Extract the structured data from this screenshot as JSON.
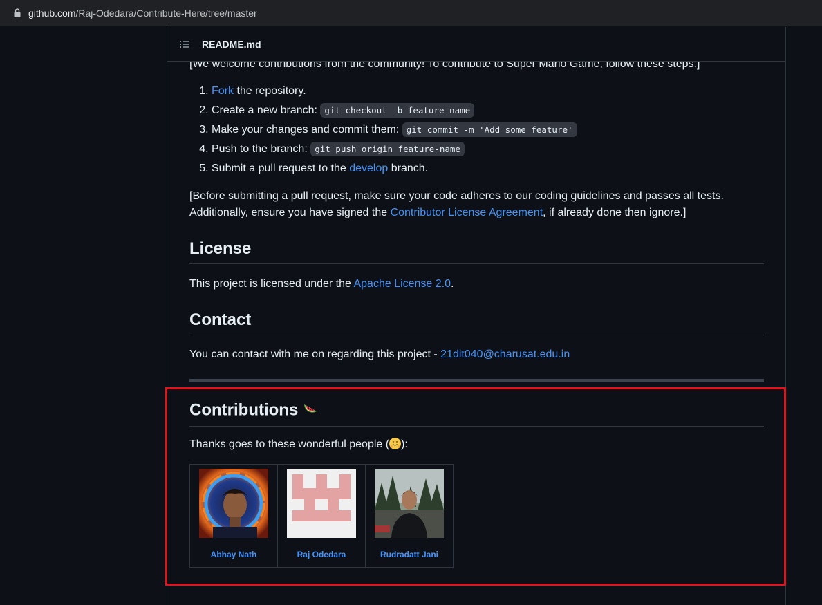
{
  "browser": {
    "url_host": "github.com",
    "url_path": "/Raj-Odedara/Contribute-Here/tree/master"
  },
  "readme": {
    "title": "README.md",
    "intro": "[We welcome contributions from the community! To contribute to Super Mario Game, follow these steps:]",
    "steps": [
      {
        "link": "Fork",
        "text": " the repository."
      },
      {
        "text": "Create a new branch: ",
        "code": "git checkout -b feature-name"
      },
      {
        "text": "Make your changes and commit them: ",
        "code": "git commit -m 'Add some feature'"
      },
      {
        "text": "Push to the branch: ",
        "code": "git push origin feature-name"
      },
      {
        "text": "Submit a pull request to the ",
        "link": "develop",
        "text_after": " branch."
      }
    ],
    "guidelines_before": "[Before submitting a pull request, make sure your code adheres to our coding guidelines and passes all tests. Additionally, ensure you have signed the ",
    "guidelines_link": "Contributor License Agreement",
    "guidelines_after": ", if already done then ignore.]",
    "license_heading": "License",
    "license_before": "This project is licensed under the ",
    "license_link": "Apache License 2.0",
    "license_after": ".",
    "contact_heading": "Contact",
    "contact_before": "You can contact with me on regarding this project - ",
    "contact_email": "21dit040@charusat.edu.in",
    "contrib_heading": "Contributions",
    "contrib_emoji": "watermelon-icon",
    "thanks_before": "Thanks goes to these wonderful people (",
    "thanks_emoji": "hugging-face-icon",
    "thanks_after": "):",
    "contributors": [
      {
        "name": "Abhay Nath"
      },
      {
        "name": "Raj Odedara"
      },
      {
        "name": "Rudradatt Jani"
      }
    ]
  },
  "colors": {
    "background": "#0d1117",
    "link": "#4493f8",
    "highlight_border": "#e0141c"
  }
}
